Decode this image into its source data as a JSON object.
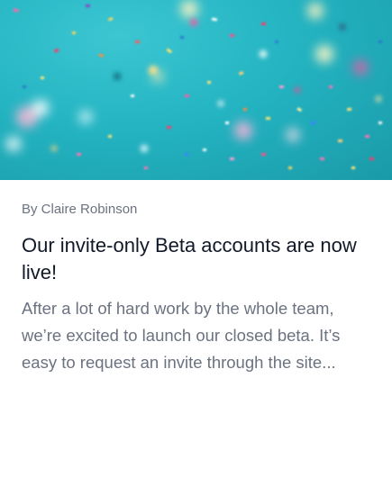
{
  "card": {
    "author": "By Claire Robinson",
    "title": "Our invite-only Beta accounts are now live!",
    "excerpt": "After a lot of hard work by the whole team, we’re excited to launch our closed beta. It’s easy to request an invite through the site..."
  },
  "image": {
    "subject": "confetti-photo",
    "colors": {
      "background": "#24b4c2",
      "accent_pink": "#f5a3c7",
      "accent_gold": "#f2d08a"
    }
  }
}
